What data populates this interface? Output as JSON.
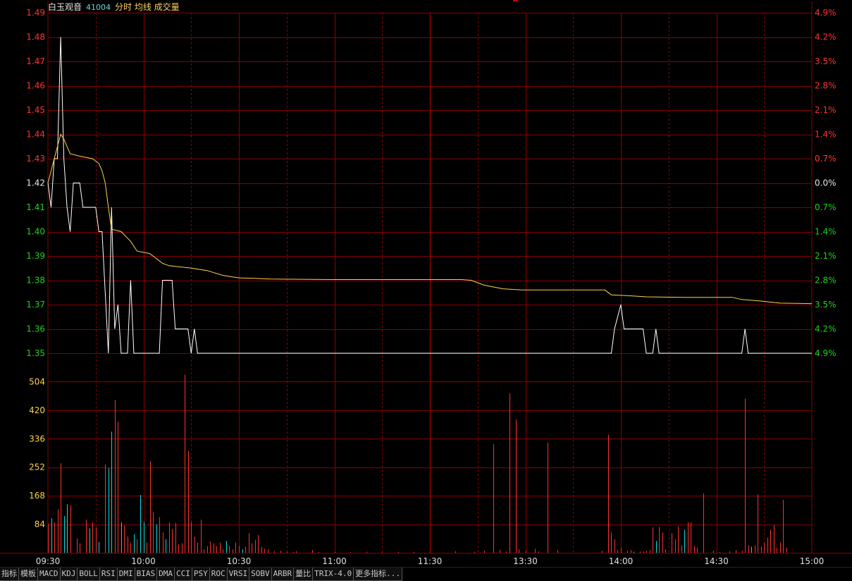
{
  "header": {
    "stock_name": "白玉观音",
    "stock_code": "41004",
    "view_labels": "分时 均线 成交量"
  },
  "colors": {
    "background": "#000000",
    "grid": "#8a0000",
    "up": "#ff3232",
    "down": "#20d020",
    "flat": "#e6e6e6",
    "price_line": "#ffffff",
    "avg_line": "#ffd24a",
    "volume_up": "#ff3030",
    "volume_down": "#00e0e0",
    "volume_label": "#ffd24a"
  },
  "price_axis": {
    "left_labels": [
      "1.49",
      "1.48",
      "1.47",
      "1.46",
      "1.45",
      "1.44",
      "1.43",
      "1.42",
      "1.41",
      "1.40",
      "1.39",
      "1.38",
      "1.37",
      "1.36",
      "1.35"
    ],
    "right_labels": [
      "4.9%",
      "4.2%",
      "3.5%",
      "2.8%",
      "2.1%",
      "1.4%",
      "0.7%",
      "0.0%",
      "0.7%",
      "1.4%",
      "2.1%",
      "2.8%",
      "3.5%",
      "4.2%",
      "4.9%"
    ],
    "prev_close": 1.42,
    "ylim": [
      1.35,
      1.49
    ]
  },
  "volume_axis": {
    "labels": [
      "504",
      "420",
      "336",
      "252",
      "168",
      "84"
    ],
    "ylim": [
      0,
      588
    ]
  },
  "time_axis": {
    "labels": [
      "09:30",
      "10:00",
      "10:30",
      "11:00",
      "11:30",
      "13:30",
      "14:00",
      "14:30",
      "15:00"
    ]
  },
  "chart_data": {
    "type": "line",
    "x_unit": "trading minute (0=09:30, 120=11:30/13:00, 240=15:00)",
    "series": [
      {
        "points": [
          [
            0,
            1.42
          ],
          [
            1,
            1.41
          ],
          [
            2,
            1.43
          ],
          [
            3,
            1.43
          ],
          [
            4,
            1.48
          ],
          [
            5,
            1.43
          ],
          [
            6,
            1.41
          ],
          [
            7,
            1.4
          ],
          [
            8,
            1.42
          ],
          [
            10,
            1.42
          ],
          [
            11,
            1.41
          ],
          [
            15,
            1.41
          ],
          [
            16,
            1.4
          ],
          [
            17,
            1.4
          ],
          [
            19,
            1.35
          ],
          [
            20,
            1.41
          ],
          [
            21,
            1.36
          ],
          [
            22,
            1.37
          ],
          [
            23,
            1.35
          ],
          [
            25,
            1.35
          ],
          [
            26,
            1.38
          ],
          [
            27,
            1.35
          ],
          [
            35,
            1.35
          ],
          [
            36,
            1.38
          ],
          [
            39,
            1.38
          ],
          [
            40,
            1.36
          ],
          [
            44,
            1.36
          ],
          [
            45,
            1.35
          ],
          [
            46,
            1.36
          ],
          [
            47,
            1.35
          ],
          [
            177,
            1.35
          ],
          [
            178,
            1.36
          ],
          [
            180,
            1.37
          ],
          [
            181,
            1.36
          ],
          [
            187,
            1.36
          ],
          [
            188,
            1.35
          ],
          [
            190,
            1.35
          ],
          [
            191,
            1.36
          ],
          [
            192,
            1.35
          ],
          [
            218,
            1.35
          ],
          [
            219,
            1.36
          ],
          [
            220,
            1.35
          ],
          [
            240,
            1.35
          ]
        ]
      },
      {
        "points": [
          [
            0,
            1.42
          ],
          [
            2,
            1.43
          ],
          [
            4,
            1.44
          ],
          [
            5,
            1.438
          ],
          [
            7,
            1.432
          ],
          [
            10,
            1.431
          ],
          [
            14,
            1.43
          ],
          [
            16,
            1.428
          ],
          [
            17,
            1.425
          ],
          [
            18,
            1.42
          ],
          [
            19,
            1.41
          ],
          [
            20,
            1.401
          ],
          [
            23,
            1.4
          ],
          [
            26,
            1.396
          ],
          [
            28,
            1.392
          ],
          [
            32,
            1.391
          ],
          [
            36,
            1.387
          ],
          [
            38,
            1.386
          ],
          [
            45,
            1.385
          ],
          [
            50,
            1.384
          ],
          [
            55,
            1.382
          ],
          [
            60,
            1.381
          ],
          [
            65,
            1.3808
          ],
          [
            70,
            1.3805
          ],
          [
            90,
            1.3803
          ],
          [
            120,
            1.3803
          ],
          [
            130,
            1.3803
          ],
          [
            133,
            1.38
          ],
          [
            137,
            1.378
          ],
          [
            143,
            1.3765
          ],
          [
            149,
            1.376
          ],
          [
            175,
            1.376
          ],
          [
            177,
            1.374
          ],
          [
            182,
            1.3737
          ],
          [
            188,
            1.3732
          ],
          [
            200,
            1.373
          ],
          [
            215,
            1.373
          ],
          [
            218,
            1.3721
          ],
          [
            223,
            1.3716
          ],
          [
            230,
            1.3706
          ],
          [
            240,
            1.3704
          ]
        ]
      }
    ],
    "volume_bars": [
      [
        0,
        85,
        "up"
      ],
      [
        1,
        102,
        "down"
      ],
      [
        2,
        90,
        "up"
      ],
      [
        3,
        128,
        "up"
      ],
      [
        4,
        264,
        "up"
      ],
      [
        5,
        108,
        "down"
      ],
      [
        6,
        143,
        "down"
      ],
      [
        7,
        140,
        "up"
      ],
      [
        9,
        42,
        "up"
      ],
      [
        10,
        28,
        "up"
      ],
      [
        12,
        98,
        "up"
      ],
      [
        13,
        72,
        "down"
      ],
      [
        14,
        90,
        "up"
      ],
      [
        15,
        75,
        "up"
      ],
      [
        16,
        32,
        "down"
      ],
      [
        18,
        260,
        "up"
      ],
      [
        19,
        250,
        "down"
      ],
      [
        20,
        357,
        "down"
      ],
      [
        21,
        450,
        "up"
      ],
      [
        22,
        386,
        "up"
      ],
      [
        23,
        90,
        "down"
      ],
      [
        24,
        80,
        "up"
      ],
      [
        25,
        48,
        "up"
      ],
      [
        26,
        30,
        "up"
      ],
      [
        27,
        55,
        "down"
      ],
      [
        28,
        40,
        "up"
      ],
      [
        29,
        170,
        "down"
      ],
      [
        30,
        90,
        "down"
      ],
      [
        31,
        30,
        "up"
      ],
      [
        32,
        270,
        "up"
      ],
      [
        33,
        120,
        "up"
      ],
      [
        34,
        84,
        "down"
      ],
      [
        35,
        105,
        "up"
      ],
      [
        36,
        60,
        "up"
      ],
      [
        37,
        40,
        "down"
      ],
      [
        38,
        90,
        "up"
      ],
      [
        39,
        70,
        "up"
      ],
      [
        40,
        88,
        "up"
      ],
      [
        41,
        25,
        "up"
      ],
      [
        42,
        28,
        "up"
      ],
      [
        43,
        525,
        "up"
      ],
      [
        44,
        300,
        "up"
      ],
      [
        45,
        90,
        "up"
      ],
      [
        46,
        48,
        "up"
      ],
      [
        47,
        30,
        "up"
      ],
      [
        48,
        98,
        "up"
      ],
      [
        49,
        10,
        "up"
      ],
      [
        50,
        20,
        "up"
      ],
      [
        51,
        33,
        "up"
      ],
      [
        52,
        28,
        "up"
      ],
      [
        53,
        20,
        "up"
      ],
      [
        54,
        30,
        "up"
      ],
      [
        55,
        10,
        "up"
      ],
      [
        56,
        35,
        "down"
      ],
      [
        57,
        20,
        "up"
      ],
      [
        58,
        10,
        "up"
      ],
      [
        59,
        30,
        "up"
      ],
      [
        60,
        20,
        "up"
      ],
      [
        61,
        10,
        "down"
      ],
      [
        62,
        18,
        "up"
      ],
      [
        63,
        58,
        "up"
      ],
      [
        64,
        28,
        "up"
      ],
      [
        65,
        38,
        "up"
      ],
      [
        66,
        52,
        "up"
      ],
      [
        67,
        18,
        "up"
      ],
      [
        68,
        12,
        "up"
      ],
      [
        69,
        10,
        "up"
      ],
      [
        71,
        5,
        "up"
      ],
      [
        73,
        6,
        "up"
      ],
      [
        75,
        3,
        "up"
      ],
      [
        77,
        2,
        "up"
      ],
      [
        78,
        5,
        "up"
      ],
      [
        83,
        8,
        "up"
      ],
      [
        85,
        2,
        "up"
      ],
      [
        90,
        3,
        "up"
      ],
      [
        95,
        2,
        "up"
      ],
      [
        100,
        3,
        "up"
      ],
      [
        105,
        2,
        "up"
      ],
      [
        110,
        3,
        "up"
      ],
      [
        115,
        2,
        "up"
      ],
      [
        128,
        5,
        "up"
      ],
      [
        134,
        3,
        "up"
      ],
      [
        137,
        6,
        "up"
      ],
      [
        140,
        320,
        "up"
      ],
      [
        142,
        8,
        "up"
      ],
      [
        144,
        4,
        "up"
      ],
      [
        145,
        470,
        "up"
      ],
      [
        147,
        393,
        "up"
      ],
      [
        148,
        10,
        "up"
      ],
      [
        150,
        6,
        "up"
      ],
      [
        153,
        12,
        "up"
      ],
      [
        154,
        4,
        "up"
      ],
      [
        157,
        325,
        "up"
      ],
      [
        160,
        8,
        "up"
      ],
      [
        174,
        6,
        "up"
      ],
      [
        176,
        348,
        "up"
      ],
      [
        177,
        60,
        "up"
      ],
      [
        178,
        40,
        "up"
      ],
      [
        179,
        8,
        "up"
      ],
      [
        180,
        15,
        "up"
      ],
      [
        182,
        6,
        "up"
      ],
      [
        183,
        8,
        "up"
      ],
      [
        184,
        3,
        "down"
      ],
      [
        186,
        4,
        "up"
      ],
      [
        187,
        4,
        "up"
      ],
      [
        188,
        6,
        "up"
      ],
      [
        189,
        8,
        "up"
      ],
      [
        190,
        75,
        "up"
      ],
      [
        191,
        35,
        "down"
      ],
      [
        192,
        76,
        "up"
      ],
      [
        193,
        60,
        "up"
      ],
      [
        194,
        10,
        "up"
      ],
      [
        196,
        58,
        "up"
      ],
      [
        197,
        40,
        "up"
      ],
      [
        198,
        78,
        "up"
      ],
      [
        199,
        22,
        "up"
      ],
      [
        200,
        68,
        "down"
      ],
      [
        201,
        90,
        "up"
      ],
      [
        202,
        90,
        "up"
      ],
      [
        203,
        20,
        "up"
      ],
      [
        204,
        15,
        "up"
      ],
      [
        206,
        175,
        "up"
      ],
      [
        209,
        6,
        "up"
      ],
      [
        211,
        2,
        "up"
      ],
      [
        214,
        4,
        "up"
      ],
      [
        216,
        8,
        "up"
      ],
      [
        218,
        6,
        "up"
      ],
      [
        219,
        454,
        "up"
      ],
      [
        220,
        22,
        "up"
      ],
      [
        221,
        18,
        "down"
      ],
      [
        222,
        22,
        "up"
      ],
      [
        223,
        172,
        "up"
      ],
      [
        224,
        18,
        "up"
      ],
      [
        225,
        30,
        "up"
      ],
      [
        226,
        45,
        "up"
      ],
      [
        227,
        68,
        "up"
      ],
      [
        228,
        82,
        "up"
      ],
      [
        229,
        15,
        "up"
      ],
      [
        230,
        30,
        "up"
      ],
      [
        231,
        156,
        "up"
      ],
      [
        232,
        15,
        "up"
      ]
    ],
    "xlim": [
      0,
      240
    ]
  },
  "indicator_tabs": [
    "指标",
    "模板",
    "MACD",
    "KDJ",
    "BOLL",
    "RSI",
    "DMI",
    "BIAS",
    "DMA",
    "CCI",
    "PSY",
    "ROC",
    "VRSI",
    "SOBV",
    "ARBR",
    "量比",
    "TRIX-4.0",
    "更多指标..."
  ]
}
